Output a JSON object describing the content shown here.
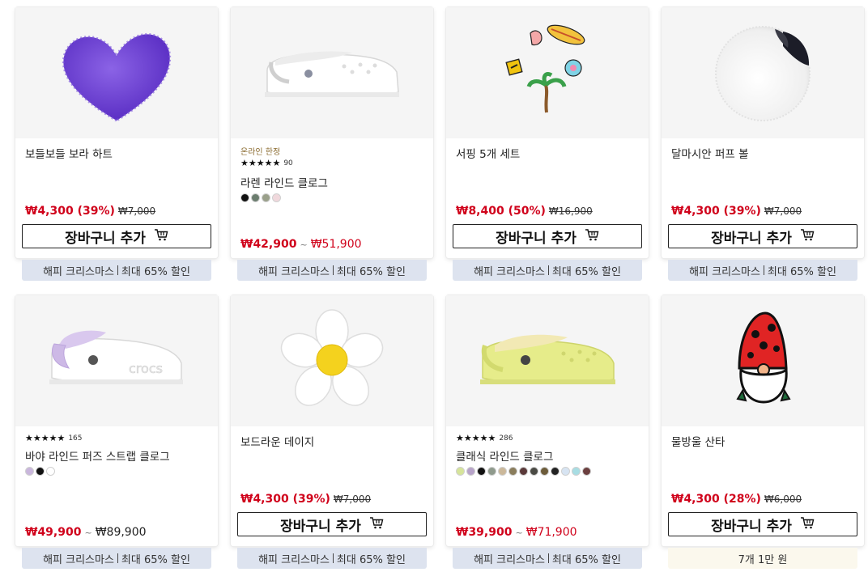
{
  "products": [
    {
      "title": "보들보들 보라 하트",
      "sale_price": "₩4,300 (39%)",
      "original_price": "₩7,000",
      "cart_label": "장바구니 추가",
      "promo": [
        "해피 크리스마스",
        "최대 65% 할인"
      ]
    },
    {
      "online_only": "온라인 한정",
      "rating_stars": "★★★★★",
      "rating_count": "90",
      "title": "라렌 라인드 클로그",
      "swatch_colors": [
        "#111111",
        "#6b7d6e",
        "#9aa08a",
        "#f0d8dc"
      ],
      "price_min": "₩42,900",
      "range_sep": "~",
      "price_max": "₩51,900",
      "promo": [
        "해피 크리스마스",
        "최대 65% 할인"
      ]
    },
    {
      "title": "서핑 5개 세트",
      "sale_price": "₩8,400 (50%)",
      "original_price": "₩16,900",
      "cart_label": "장바구니 추가",
      "promo": [
        "해피 크리스마스",
        "최대 65% 할인"
      ]
    },
    {
      "title": "달마시안 퍼프 볼",
      "sale_price": "₩4,300 (39%)",
      "original_price": "₩7,000",
      "cart_label": "장바구니 추가",
      "promo": [
        "해피 크리스마스",
        "최대 65% 할인"
      ]
    },
    {
      "rating_stars": "★★★★★",
      "rating_count": "165",
      "title": "바야 라인드 퍼즈 스트랩 클로그",
      "swatch_colors": [
        "#c9b6dc",
        "#111111",
        "#ffffff"
      ],
      "price_min": "₩49,900",
      "range_sep": "~",
      "price_max": "₩89,900",
      "promo": [
        "해피 크리스마스",
        "최대 65% 할인"
      ]
    },
    {
      "title": "보드라운 데이지",
      "sale_price": "₩4,300 (39%)",
      "original_price": "₩7,000",
      "cart_label": "장바구니 추가",
      "promo": [
        "해피 크리스마스",
        "최대 65% 할인"
      ]
    },
    {
      "rating_stars": "★★★★★",
      "rating_count": "286",
      "title": "클래식 라인드 클로그",
      "swatch_colors": [
        "#d6e49a",
        "#b7a3c9",
        "#111111",
        "#8f9a8c",
        "#cbb89a",
        "#8a7d5c",
        "#5b3a3a",
        "#4a4a44",
        "#6d5c3a",
        "#222222",
        "#d7e4f2",
        "#a8dde3",
        "#6b3f3f"
      ],
      "price_min": "₩39,900",
      "range_sep": "~",
      "price_max": "₩71,900",
      "promo": [
        "해피 크리스마스",
        "최대 65% 할인"
      ]
    },
    {
      "title": "물방울 산타",
      "sale_price": "₩4,300 (28%)",
      "original_price": "₩6,000",
      "cart_label": "장바구니 추가",
      "promo_single": "7개 1만 원"
    }
  ],
  "icons": {
    "cart": "shopping-cart-icon"
  },
  "colors": {
    "sale_red": "#d0021b",
    "promo_bg": "#dde3ef",
    "promo_alt_bg": "#fbf8ed"
  }
}
